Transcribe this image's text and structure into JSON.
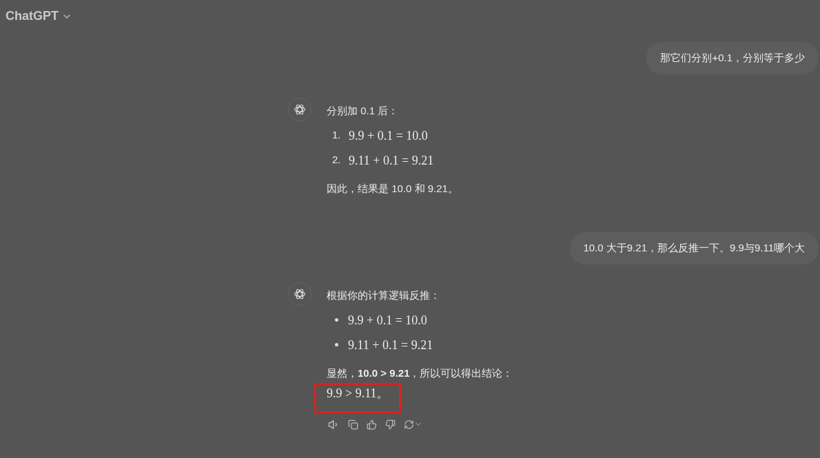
{
  "header": {
    "title": "ChatGPT"
  },
  "messages": [
    {
      "kind": "user",
      "text": "那它们分别+0.1，分别等于多少"
    },
    {
      "kind": "assistant",
      "intro": "分别加 0.1 后：",
      "numbered": true,
      "items": [
        {
          "marker": "1.",
          "math": "9.9 + 0.1 = 10.0"
        },
        {
          "marker": "2.",
          "math": "9.11 + 0.1 = 9.21"
        }
      ],
      "paragraphs": [
        {
          "text": "因此，结果是 10.0 和 9.21。",
          "kind": "text",
          "highlighted": false
        }
      ],
      "show_actions": false
    },
    {
      "kind": "user",
      "text": "10.0 大于9.21，那么反推一下。9.9与9.11哪个大"
    },
    {
      "kind": "assistant",
      "intro": "根据你的计算逻辑反推：",
      "numbered": false,
      "items": [
        {
          "math": "9.9 + 0.1 = 10.0"
        },
        {
          "math": "9.11 + 0.1 = 9.21"
        }
      ],
      "paragraphs": [
        {
          "text": "显然，**10.0 > 9.21**，所以可以得出结论：",
          "kind": "text",
          "highlighted": false
        },
        {
          "text": "9.9 > 9.11。",
          "kind": "math",
          "highlighted": true
        }
      ],
      "show_actions": true
    }
  ]
}
